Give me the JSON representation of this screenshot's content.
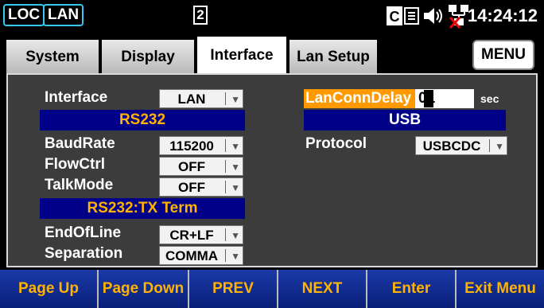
{
  "status": {
    "loc": "LOC",
    "lan": "LAN",
    "page_indicator": "2",
    "ce_label": "C",
    "time": "14:24:12"
  },
  "tabs": [
    {
      "label": "System"
    },
    {
      "label": "Display"
    },
    {
      "label": "Interface"
    },
    {
      "label": "Lan Setup"
    }
  ],
  "menu_label": "MENU",
  "left": {
    "interface_label": "Interface",
    "interface_value": "LAN",
    "rs232_header": "RS232",
    "baudrate_label": "BaudRate",
    "baudrate_value": "115200",
    "flowctrl_label": "FlowCtrl",
    "flowctrl_value": "OFF",
    "talkmode_label": "TalkMode",
    "talkmode_value": "OFF",
    "txterm_header": "RS232:TX Term",
    "eol_label": "EndOfLine",
    "eol_value": "CR+LF",
    "separation_label": "Separation",
    "separation_value": "COMMA"
  },
  "right": {
    "lanconn_label": "LanConnDelay",
    "lanconn_value": "01",
    "lanconn_unit": "sec",
    "usb_header": "USB",
    "protocol_label": "Protocol",
    "protocol_value": "USBCDC"
  },
  "fkeys": [
    {
      "label": "Page Up"
    },
    {
      "label": "Page Down"
    },
    {
      "label": "PREV"
    },
    {
      "label": "NEXT"
    },
    {
      "label": "Enter"
    },
    {
      "label": "Exit Menu"
    }
  ],
  "colors": {
    "accent_orange": "#ff9900",
    "header_blue": "#000088",
    "fkey_text": "#ffb300",
    "badge_border": "#35c9f0"
  }
}
